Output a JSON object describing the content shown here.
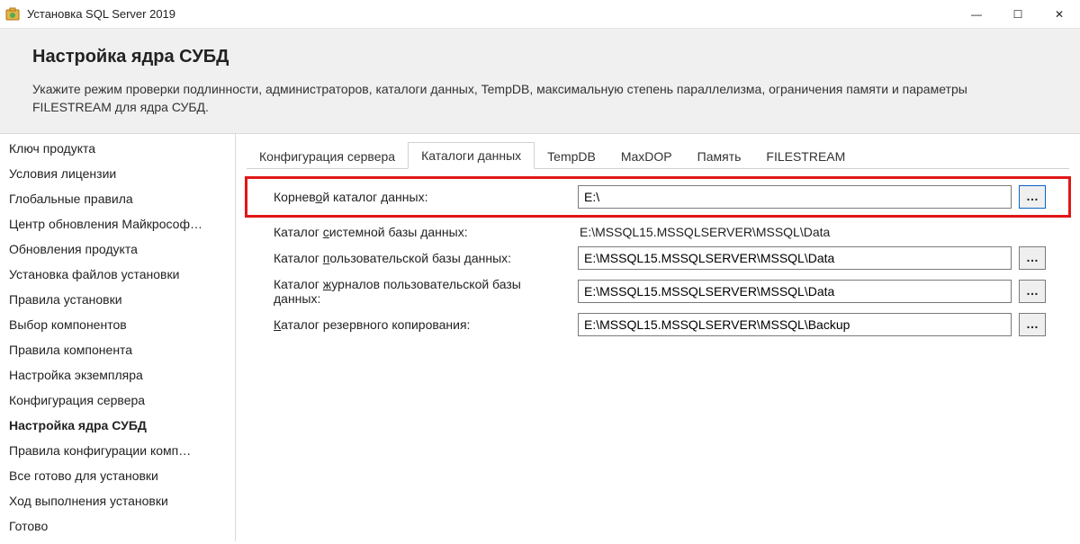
{
  "window": {
    "title": "Установка SQL Server 2019",
    "min_glyph": "—",
    "max_glyph": "☐",
    "close_glyph": "✕"
  },
  "header": {
    "title": "Настройка ядра СУБД",
    "subtitle": "Укажите режим проверки подлинности, администраторов, каталоги данных, TempDB, максимальную степень параллелизма, ограничения памяти и параметры FILESTREAM для ядра СУБД."
  },
  "sidebar": {
    "items": [
      "Ключ продукта",
      "Условия лицензии",
      "Глобальные правила",
      "Центр обновления Майкрософ…",
      "Обновления продукта",
      "Установка файлов установки",
      "Правила установки",
      "Выбор компонентов",
      "Правила компонента",
      "Настройка экземпляра",
      "Конфигурация сервера",
      "Настройка ядра СУБД",
      "Правила конфигурации комп…",
      "Все готово для установки",
      "Ход выполнения установки",
      "Готово"
    ],
    "active_index": 11
  },
  "tabs": {
    "items": [
      "Конфигурация сервера",
      "Каталоги данных",
      "TempDB",
      "MaxDOP",
      "Память",
      "FILESTREAM"
    ],
    "active_index": 1
  },
  "fields": {
    "root": {
      "label_pre": "Корнев",
      "label_m": "о",
      "label_post": "й каталог данных:",
      "value": "E:\\",
      "browse": "…"
    },
    "system_db": {
      "label_pre": "Каталог ",
      "label_m": "с",
      "label_post": "истемной базы данных:",
      "value": "E:\\MSSQL15.MSSQLSERVER\\MSSQL\\Data"
    },
    "user_db": {
      "label_pre": "Каталог ",
      "label_m": "п",
      "label_post": "ользовательской базы данных:",
      "value": "E:\\MSSQL15.MSSQLSERVER\\MSSQL\\Data",
      "browse": "…"
    },
    "user_log": {
      "label_pre": "Каталог ",
      "label_m": "ж",
      "label_post": "урналов пользовательской базы данных:",
      "value": "E:\\MSSQL15.MSSQLSERVER\\MSSQL\\Data",
      "browse": "…"
    },
    "backup": {
      "label_pre": "",
      "label_m": "К",
      "label_post": "аталог резервного копирования:",
      "value": "E:\\MSSQL15.MSSQLSERVER\\MSSQL\\Backup",
      "browse": "…"
    }
  }
}
